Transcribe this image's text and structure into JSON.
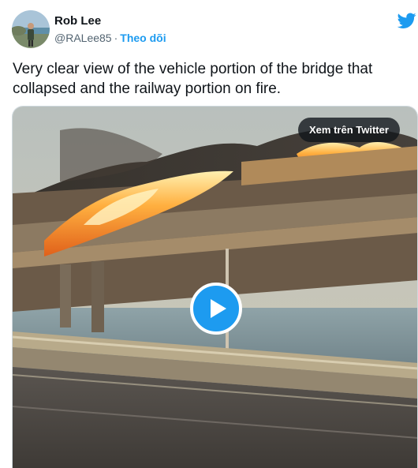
{
  "author": {
    "name": "Rob Lee",
    "handle": "@RALee85",
    "separator": "·",
    "follow_label": "Theo dõi"
  },
  "icons": {
    "avatar": "avatar",
    "brand": "twitter-bird-icon",
    "play": "play-icon"
  },
  "tweet": {
    "text": "Very clear view of the vehicle portion of the bridge that collapsed and the railway portion on fire."
  },
  "media": {
    "watch_on_twitter_label": "Xem trên Twitter",
    "type": "video"
  },
  "colors": {
    "accent": "#1d9bf0",
    "text_primary": "#0f1419",
    "text_secondary": "#536471"
  }
}
